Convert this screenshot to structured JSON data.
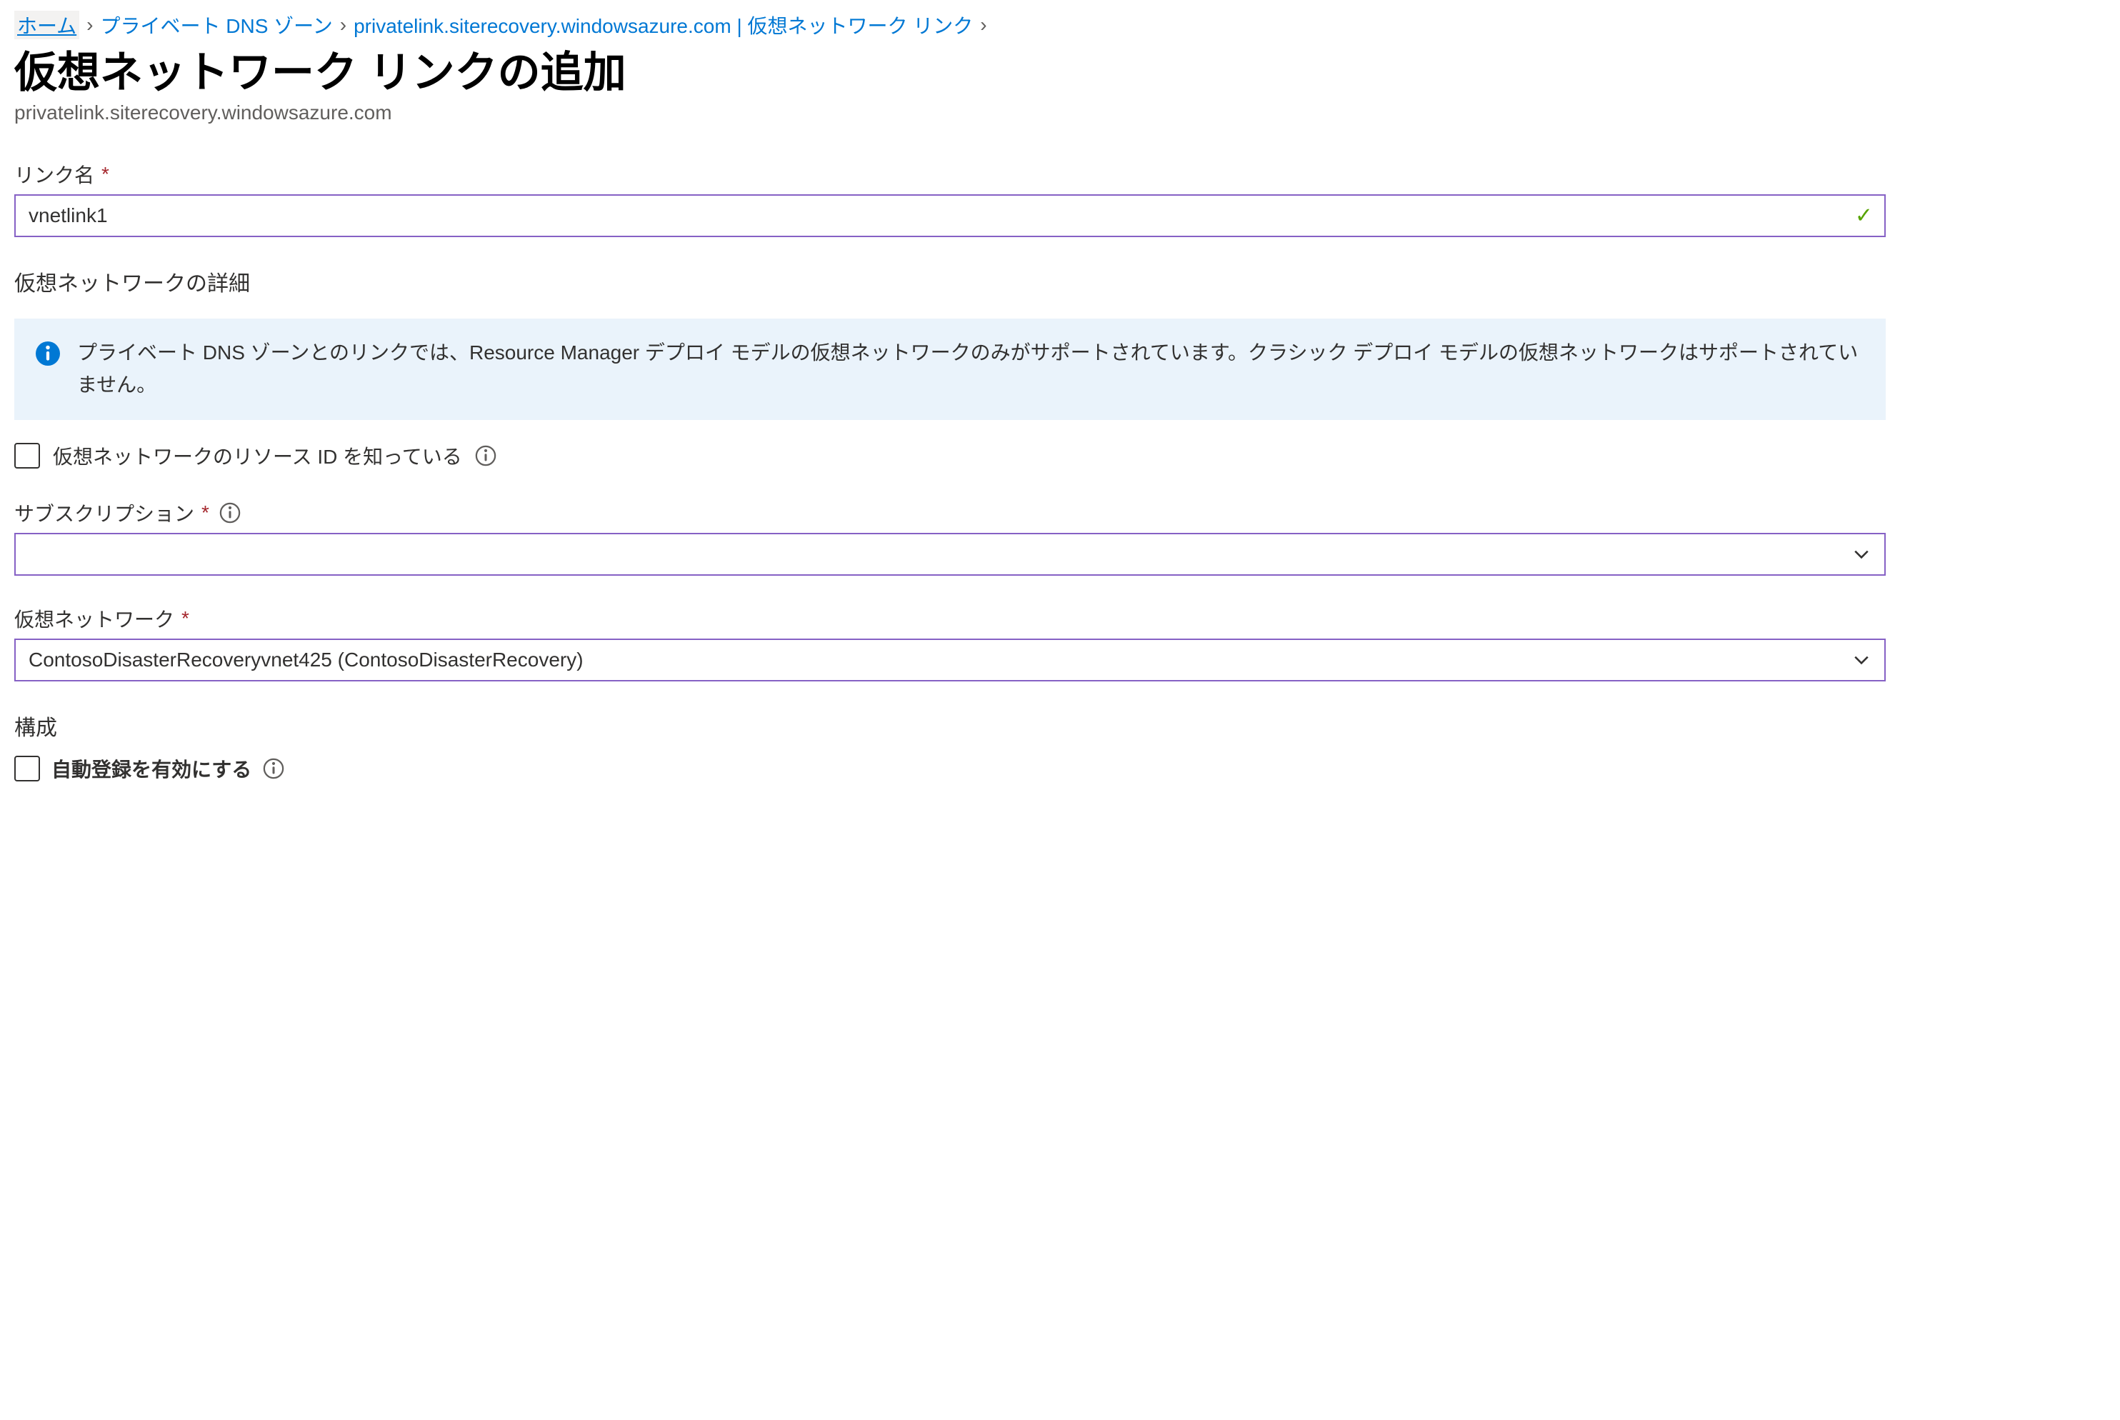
{
  "breadcrumb": {
    "home": "ホーム",
    "dns_zones": "プライベート DNS ゾーン",
    "zone": "privatelink.siterecovery.windowsazure.com | 仮想ネットワーク リンク"
  },
  "header": {
    "title": "仮想ネットワーク リンクの追加",
    "subtitle": "privatelink.siterecovery.windowsazure.com"
  },
  "fields": {
    "link_name_label": "リンク名",
    "link_name_value": "vnetlink1",
    "vnet_details_heading": "仮想ネットワークの詳細",
    "info_text": "プライベート DNS ゾーンとのリンクでは、Resource Manager デプロイ モデルの仮想ネットワークのみがサポートされています。クラシック デプロイ モデルの仮想ネットワークはサポートされていません。",
    "know_resource_id_label": "仮想ネットワークのリソース ID を知っている",
    "subscription_label": "サブスクリプション",
    "subscription_value": "",
    "vnet_label": "仮想ネットワーク",
    "vnet_value": "ContosoDisasterRecoveryvnet425 (ContosoDisasterRecovery)",
    "config_heading": "構成",
    "auto_reg_label": "自動登録を有効にする"
  },
  "icons": {
    "valid_check": "✓"
  }
}
